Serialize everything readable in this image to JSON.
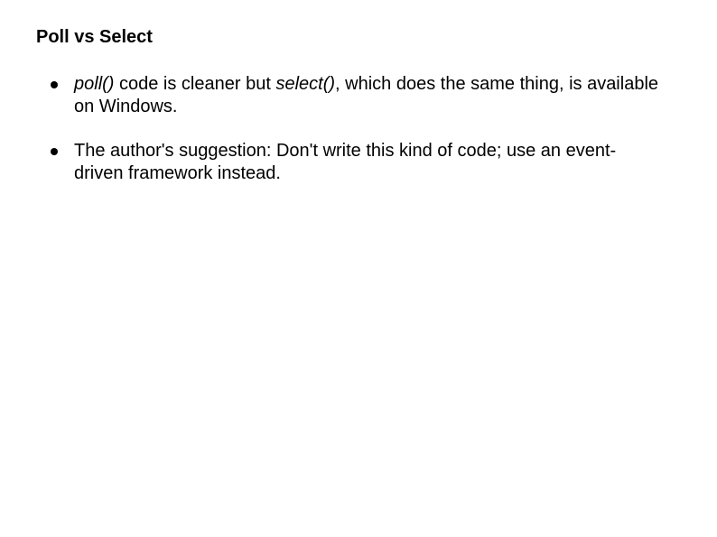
{
  "slide": {
    "title": "Poll vs Select",
    "bullets": [
      {
        "parts": [
          {
            "text": "poll()",
            "italic": true
          },
          {
            "text": " code is cleaner but ",
            "italic": false
          },
          {
            "text": "select()",
            "italic": true
          },
          {
            "text": ", which does the same thing, is available on Windows.",
            "italic": false
          }
        ]
      },
      {
        "parts": [
          {
            "text": "The author's suggestion: Don't write this kind of code; use an event-driven framework instead.",
            "italic": false
          }
        ]
      }
    ]
  }
}
